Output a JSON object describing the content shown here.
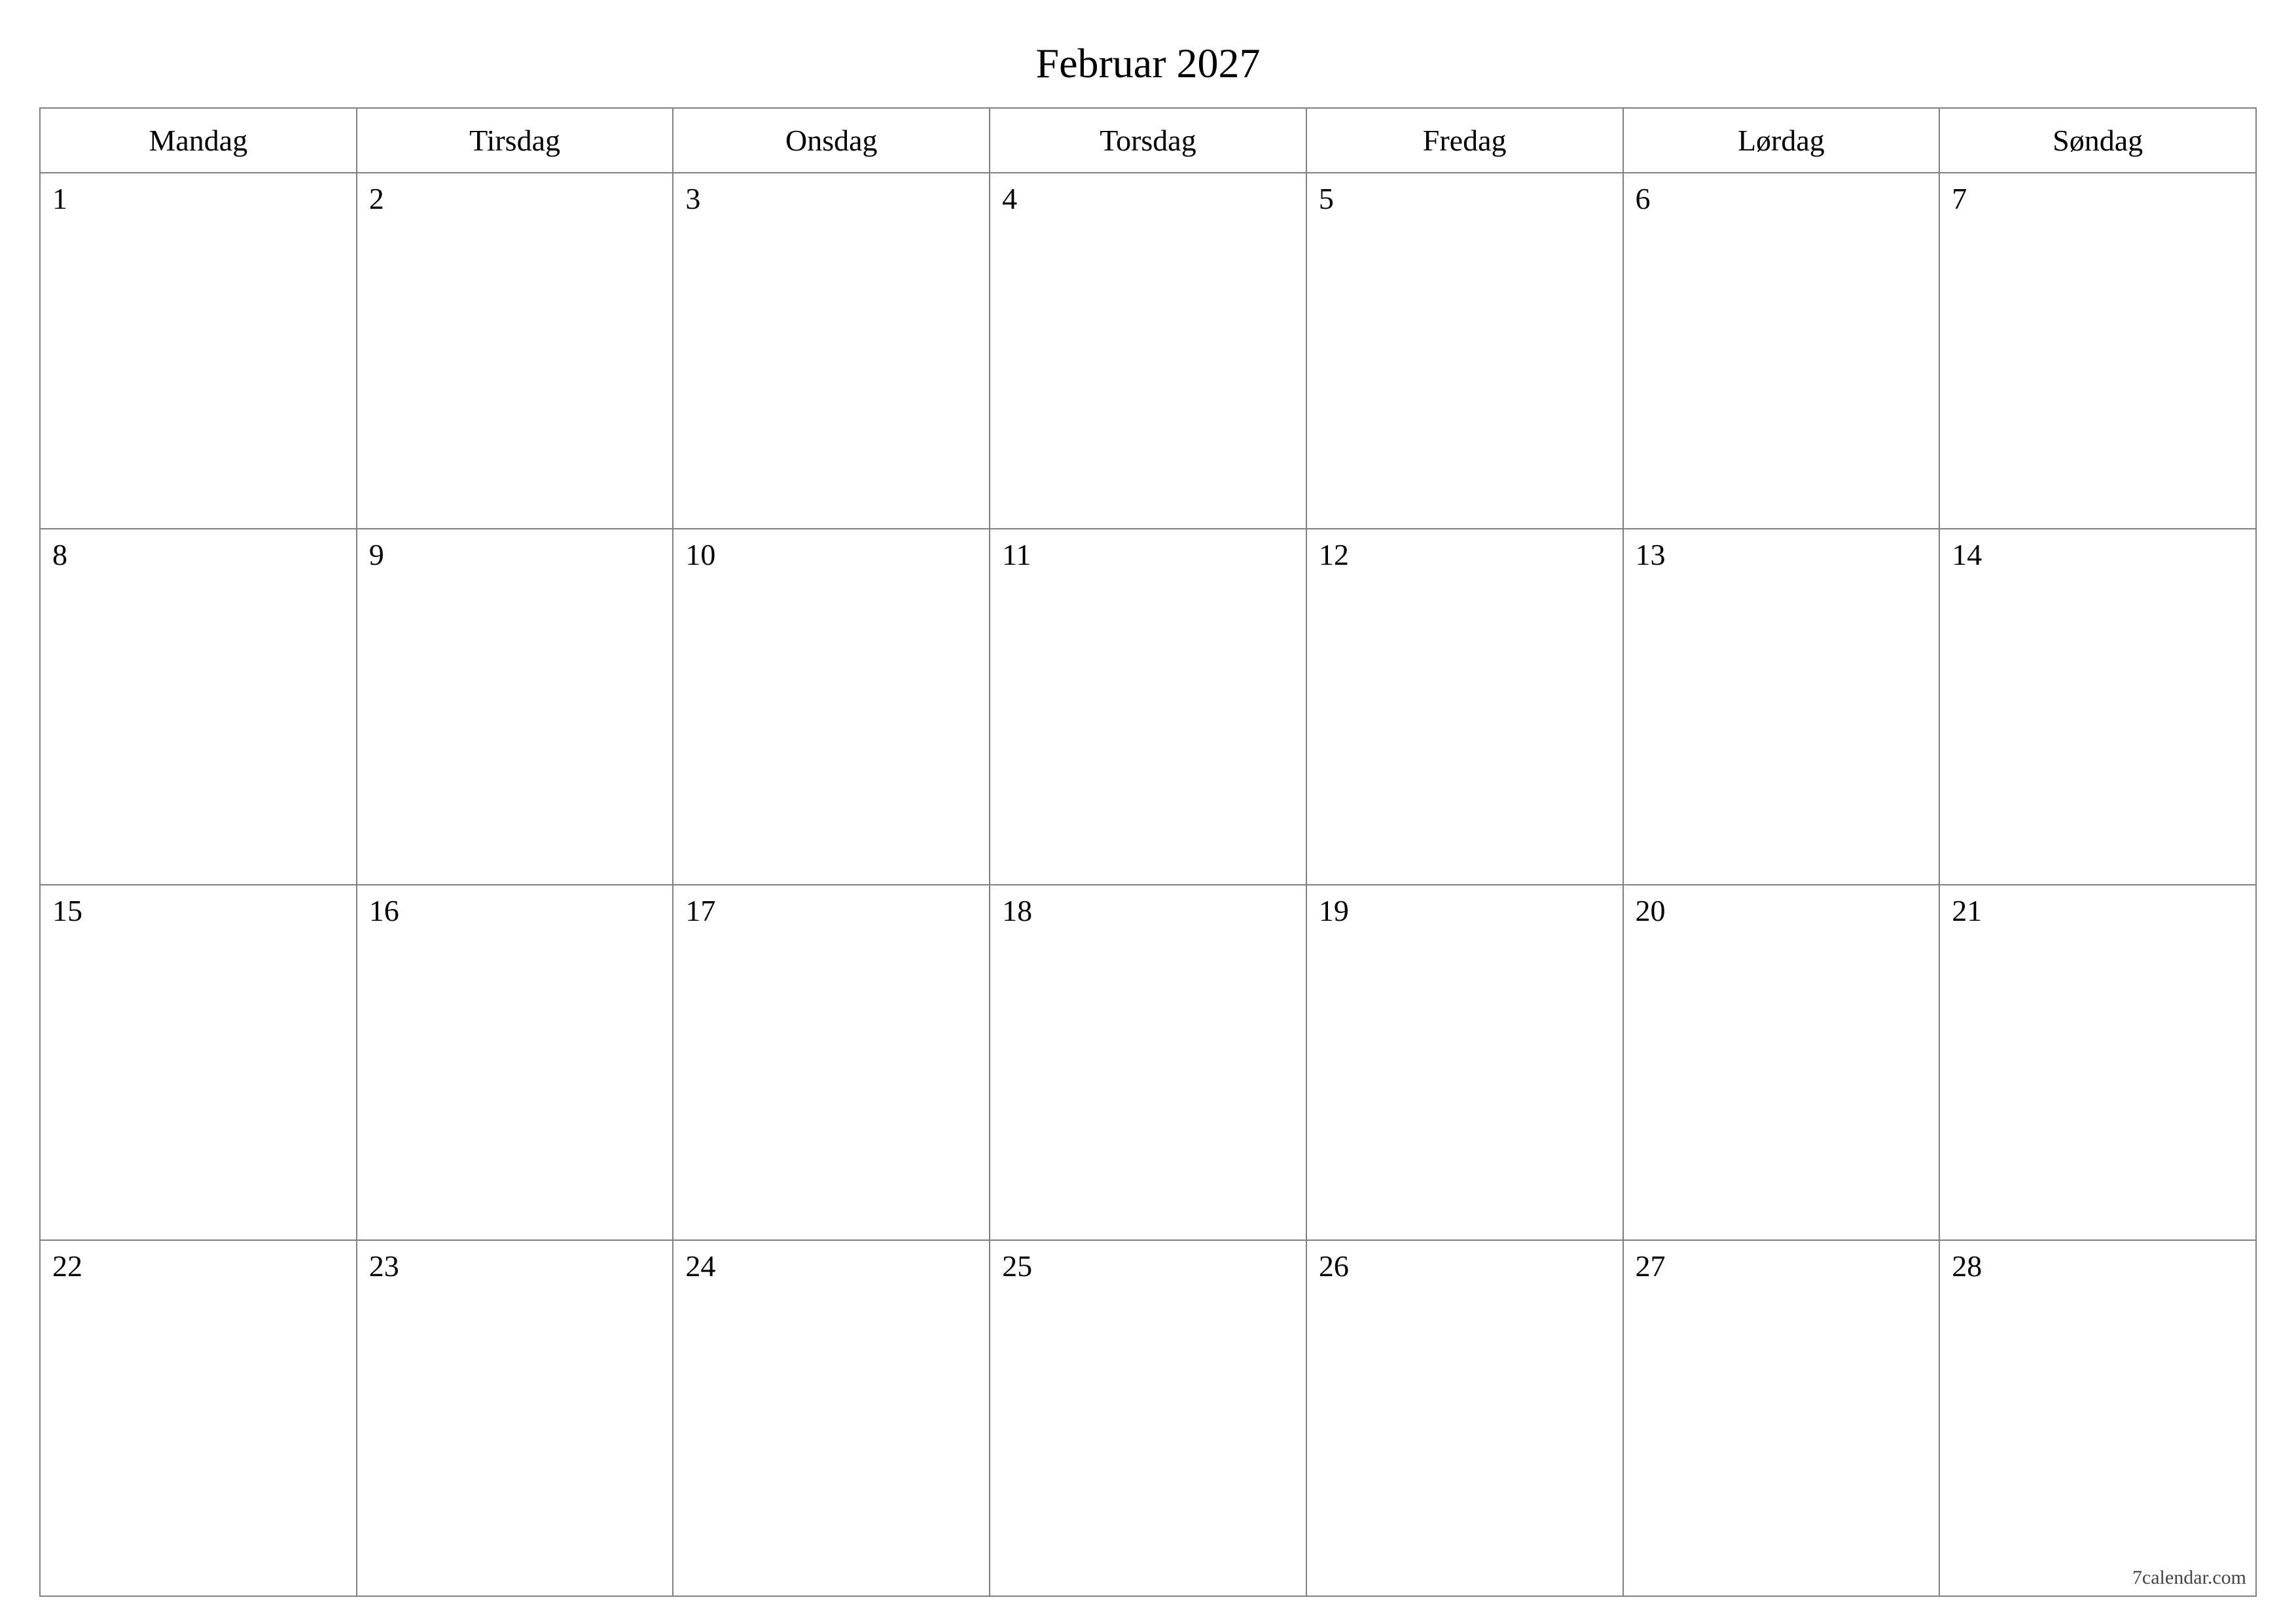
{
  "title": "Februar 2027",
  "weekdays": [
    "Mandag",
    "Tirsdag",
    "Onsdag",
    "Torsdag",
    "Fredag",
    "Lørdag",
    "Søndag"
  ],
  "weeks": [
    [
      "1",
      "2",
      "3",
      "4",
      "5",
      "6",
      "7"
    ],
    [
      "8",
      "9",
      "10",
      "11",
      "12",
      "13",
      "14"
    ],
    [
      "15",
      "16",
      "17",
      "18",
      "19",
      "20",
      "21"
    ],
    [
      "22",
      "23",
      "24",
      "25",
      "26",
      "27",
      "28"
    ]
  ],
  "footer": "7calendar.com"
}
